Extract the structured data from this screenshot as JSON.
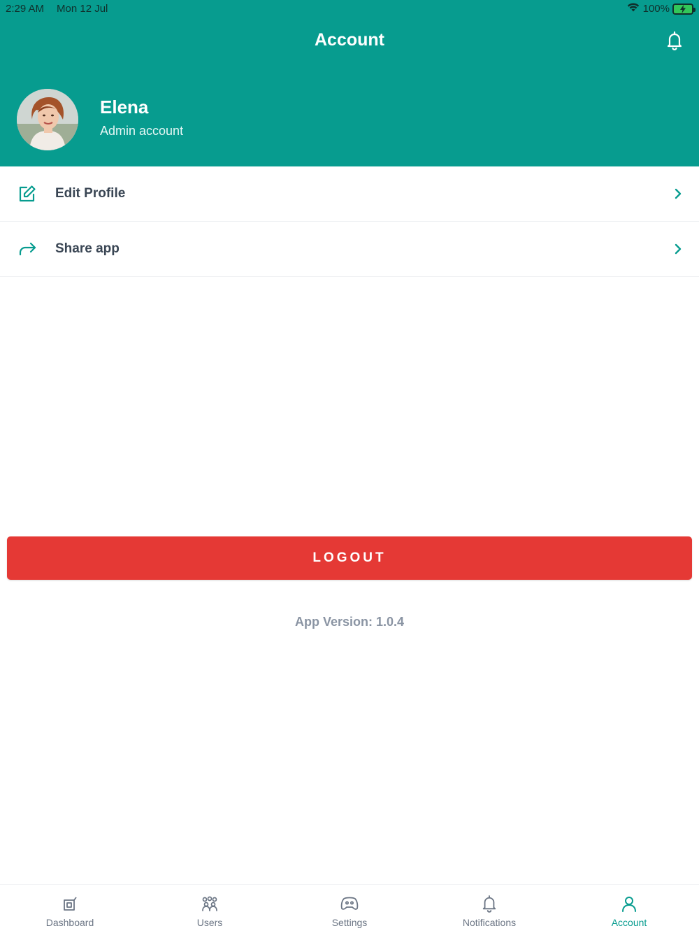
{
  "status_bar": {
    "time": "2:29 AM",
    "date": "Mon 12 Jul",
    "battery": "100%"
  },
  "header": {
    "title": "Account",
    "bell_icon": "bell-icon"
  },
  "profile": {
    "name": "Elena",
    "role": "Admin account"
  },
  "menu": [
    {
      "label": "Edit Profile",
      "icon": "edit-icon"
    },
    {
      "label": "Share app",
      "icon": "share-icon"
    }
  ],
  "logout": {
    "label": "LOGOUT"
  },
  "app_version": "App Version: 1.0.4",
  "tabs": [
    {
      "label": "Dashboard",
      "icon": "dashboard-icon",
      "active": false
    },
    {
      "label": "Users",
      "icon": "users-icon",
      "active": false
    },
    {
      "label": "Settings",
      "icon": "gamepad-icon",
      "active": false
    },
    {
      "label": "Notifications",
      "icon": "bell-icon",
      "active": false
    },
    {
      "label": "Account",
      "icon": "user-icon",
      "active": true
    }
  ],
  "colors": {
    "header": "#079c8f",
    "accent": "#079c8f",
    "logout": "#e53935",
    "text_muted": "#8a94a3"
  }
}
